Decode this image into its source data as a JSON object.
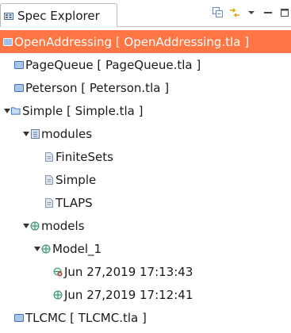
{
  "view": {
    "title": "Spec Explorer",
    "toolbar": [
      "link-with-editor-icon",
      "view-menu-icon",
      "minimize-icon",
      "maximize-icon"
    ]
  },
  "tree": {
    "specs": [
      {
        "label": "OpenAddressing [ OpenAddressing.tla ]",
        "selected": true
      },
      {
        "label": "PageQueue [ PageQueue.tla ]"
      },
      {
        "label": "Peterson [ Peterson.tla ]"
      },
      {
        "label": "Simple [ Simple.tla ]",
        "expanded": true
      },
      {
        "label": "TLCMC [ TLCMC.tla ]"
      }
    ],
    "modules_folder": "modules",
    "modules": [
      "FiniteSets",
      "Simple",
      "TLAPS"
    ],
    "models_folder": "models",
    "model": "Model_1",
    "snapshots": [
      "Jun 27,2019 17:13:43",
      "Jun 27,2019 17:12:41"
    ]
  },
  "colors": {
    "selection": "#ff7543",
    "spec_icon": "#3b6fb6",
    "module_icon": "#7a8fb0",
    "model_icon": "#3a8a6e",
    "snapshot_error": "#c0392b"
  }
}
